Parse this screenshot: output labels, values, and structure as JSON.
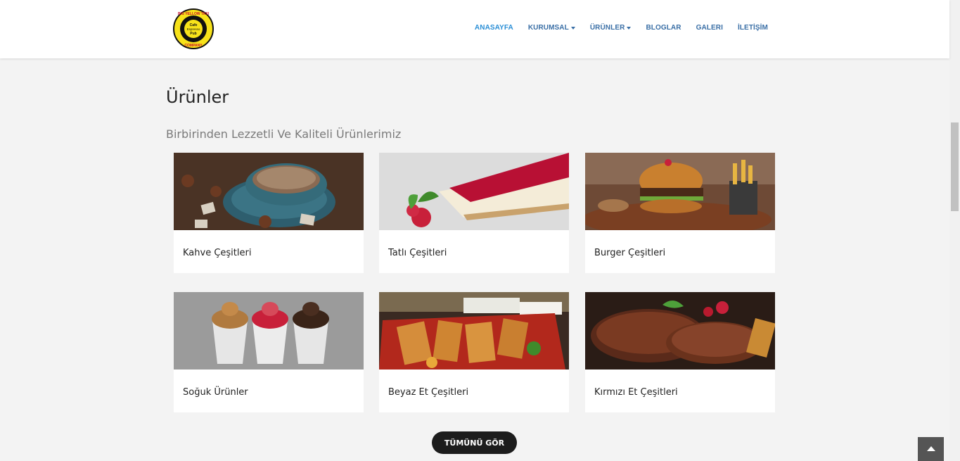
{
  "logo": {
    "top_text": "BIG YELLOW TAXI",
    "bottom_text": "COMPANY",
    "center_1": "Cafe",
    "center_2": "Espresso",
    "center_3": "Pub"
  },
  "nav": {
    "items": [
      {
        "label": "ANASAYFA",
        "active": true,
        "dropdown": false
      },
      {
        "label": "KURUMSAL",
        "active": false,
        "dropdown": true
      },
      {
        "label": "ÜRÜNLER",
        "active": false,
        "dropdown": true
      },
      {
        "label": "BLOGLAR",
        "active": false,
        "dropdown": false
      },
      {
        "label": "GALERI",
        "active": false,
        "dropdown": false
      },
      {
        "label": "İLETİŞİM",
        "active": false,
        "dropdown": false
      }
    ]
  },
  "section": {
    "title": "Ürünler",
    "subtitle": "Birbirinden Lezzetli Ve Kaliteli Ürünlerimiz"
  },
  "products": [
    {
      "label": "Kahve Çeşitleri"
    },
    {
      "label": "Tatlı Çeşitleri"
    },
    {
      "label": "Burger Çeşitleri"
    },
    {
      "label": "Soğuk Ürünler"
    },
    {
      "label": "Beyaz Et Çeşitleri"
    },
    {
      "label": "Kırmızı Et Çeşitleri"
    }
  ],
  "button": {
    "label": "TÜMÜNÜ GÖR"
  },
  "icons": {
    "scroll_top": "chevron-up-icon"
  },
  "colors": {
    "nav_link": "#3a6fa6",
    "nav_active": "#2b8fd6",
    "button_bg": "#1c1c1c"
  }
}
